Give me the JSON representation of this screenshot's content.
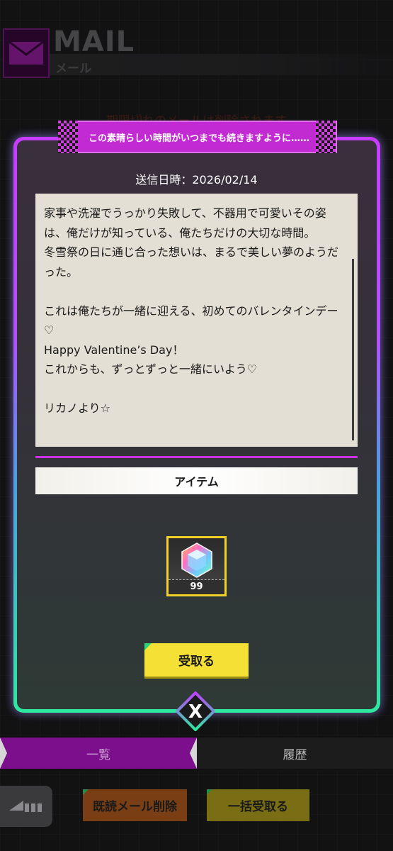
{
  "header": {
    "title": "MAIL",
    "subtitle": "メール",
    "notice": "期限切れのメールは削除されます"
  },
  "mail": {
    "title": "この素晴らしい時間がいつまでも続きますように……",
    "sent_label": "送信日時：2026/02/14",
    "body": "家事や洗濯でうっかり失敗して、不器用で可愛いその姿は、俺だけが知っている、俺たちだけの大切な時間。\n冬雪祭の日に通じ合った想いは、まるで美しい夢のようだった。\n\nこれは俺たちが一緒に迎える、初めてのバレンタインデー♡\nHappy Valentine’s Day！\nこれからも、ずっとずっと一緒にいよう♡\n\nリカノより☆",
    "items_label": "アイテム",
    "item": {
      "icon": "rainbow-crystal-icon",
      "count": "99"
    },
    "receive_label": "受取る",
    "close_label": "X"
  },
  "tabs": [
    {
      "label": "一覧",
      "active": true
    },
    {
      "label": "履歴",
      "active": false
    }
  ],
  "footer": {
    "delete_read_label": "既読メール削除",
    "bulk_receive_label": "一括受取る"
  },
  "colors": {
    "accent_purple": "#c833e6",
    "accent_green": "#2ee8a0",
    "button_yellow": "#f5e036"
  }
}
